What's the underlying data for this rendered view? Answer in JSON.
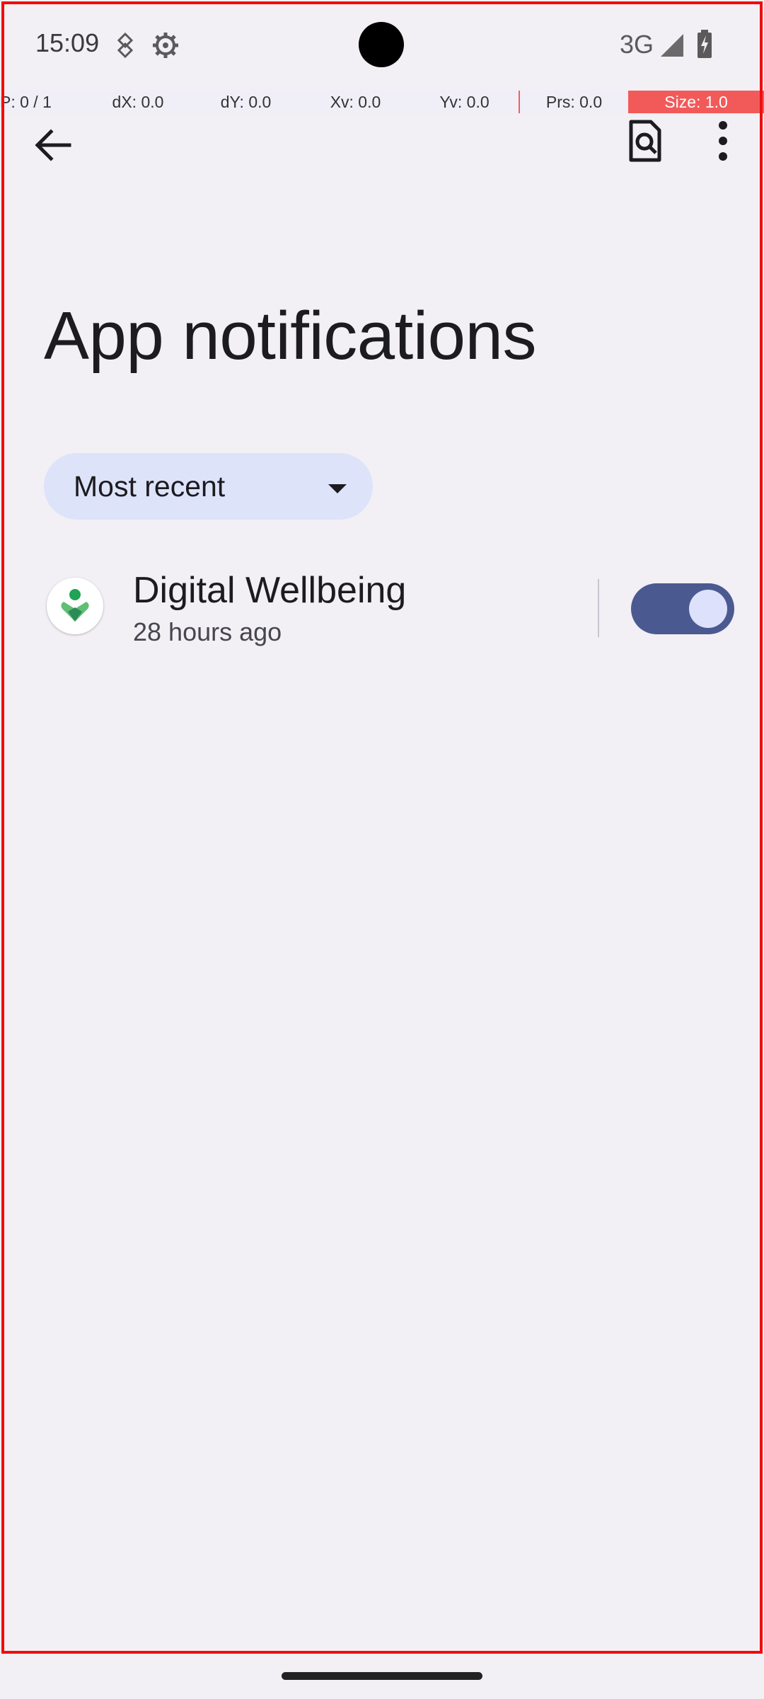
{
  "status_bar": {
    "time": "15:09",
    "network": "3G",
    "icons": [
      "data-saver-icon",
      "settings-gear-icon",
      "signal-icon",
      "battery-charging-icon"
    ]
  },
  "pointer_overlay": {
    "p": "P: 0 / 1",
    "dx": "dX: 0.0",
    "dy": "dY: 0.0",
    "xv": "Xv: 0.0",
    "yv": "Yv: 0.0",
    "prs": "Prs: 0.0",
    "size": "Size: 1.0"
  },
  "app_bar": {
    "back_icon": "back-arrow-icon",
    "search_icon": "search-settings-icon",
    "more_icon": "more-vert-icon"
  },
  "page": {
    "title": "App notifications"
  },
  "sort": {
    "selected": "Most recent"
  },
  "apps": [
    {
      "name": "Digital Wellbeing",
      "time": "28 hours ago",
      "notifications_enabled": true,
      "icon": "digital-wellbeing-icon"
    }
  ],
  "colors": {
    "background": "#f2eff5",
    "dropdown_bg": "#dde3f9",
    "toggle_on": "#4a5a91",
    "toggle_thumb": "#dde1fb",
    "debug_border": "#f20c0c"
  }
}
